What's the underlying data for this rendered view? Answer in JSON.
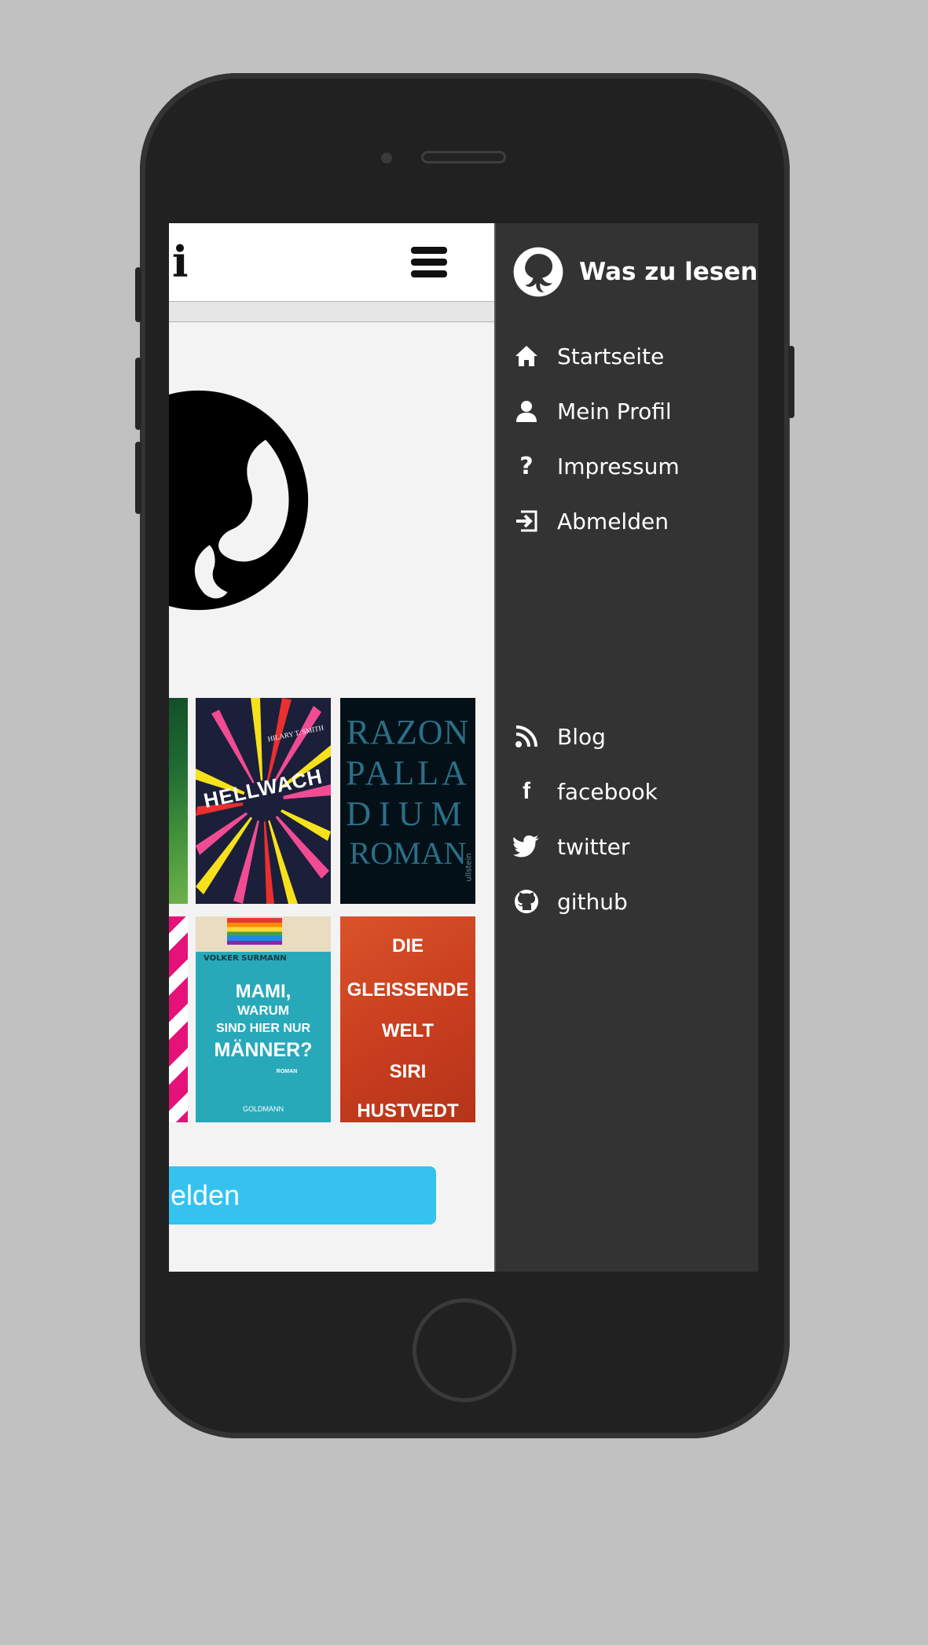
{
  "topbar": {
    "brand_initial": "i"
  },
  "drawer": {
    "title": "Was zu lesen",
    "nav": [
      {
        "label": "Startseite",
        "icon": "home-icon"
      },
      {
        "label": "Mein Profil",
        "icon": "user-icon"
      },
      {
        "label": "Impressum",
        "icon": "question-icon"
      },
      {
        "label": "Abmelden",
        "icon": "logout-icon"
      }
    ],
    "social": [
      {
        "label": "Blog",
        "icon": "rss-icon"
      },
      {
        "label": "facebook",
        "icon": "facebook-icon"
      },
      {
        "label": "twitter",
        "icon": "twitter-icon"
      },
      {
        "label": "github",
        "icon": "github-icon"
      }
    ]
  },
  "books": {
    "hellwach": {
      "title": "HELLWACH",
      "author": "HILARY T. SMITH"
    },
    "palladium": {
      "lines": [
        "RAZON",
        "PALLA",
        "DIUM",
        "ROMAN"
      ],
      "publisher": "ullstein"
    },
    "mami": {
      "author": "VOLKER SURMANN",
      "title_lines": [
        "MAMI,",
        "WARUM",
        "SIND HIER NUR",
        "MÄNNER?"
      ],
      "genre": "ROMAN",
      "publisher": "GOLDMANN"
    },
    "gleissende": {
      "title_lines": [
        "DIE",
        "GLEISSENDE",
        "WELT",
        "SIRI",
        "HUSTVEDT"
      ]
    }
  },
  "main": {
    "login_button_label": "melden"
  },
  "colors": {
    "drawer_bg": "#333333",
    "accent": "#36c2ef",
    "page_bg": "#f3f3f3"
  }
}
